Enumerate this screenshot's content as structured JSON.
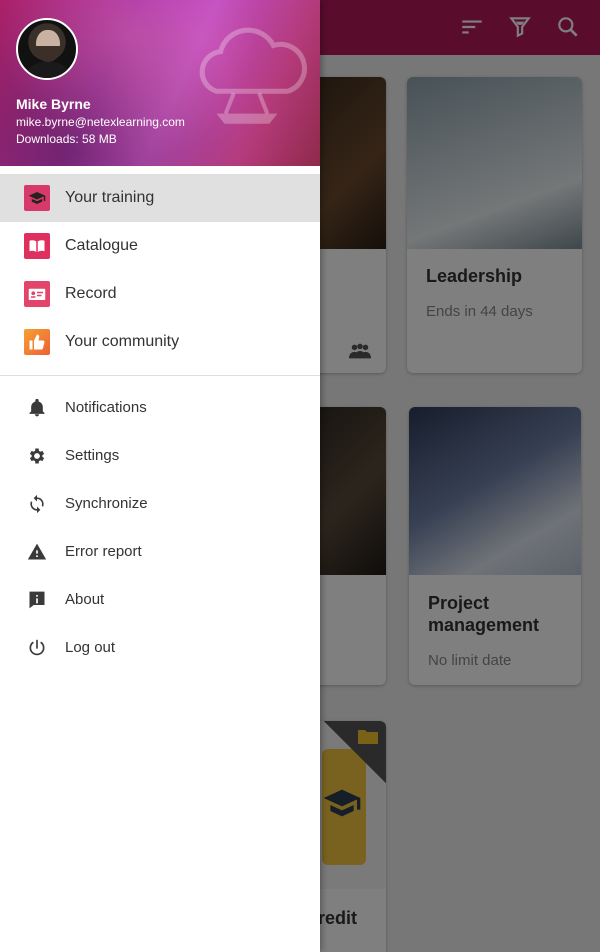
{
  "drawer": {
    "user": {
      "name": "Mike Byrne",
      "email": "mike.byrne@netexlearning.com",
      "downloads": "Downloads: 58 MB"
    },
    "main_items": [
      {
        "label": "Your training",
        "icon": "graduation-cap-icon",
        "selected": true
      },
      {
        "label": "Catalogue",
        "icon": "book-icon",
        "selected": false
      },
      {
        "label": "Record",
        "icon": "id-card-icon",
        "selected": false
      },
      {
        "label": "Your community",
        "icon": "thumbs-up-icon",
        "selected": false
      }
    ],
    "system_items": [
      {
        "label": "Notifications",
        "icon": "bell-icon"
      },
      {
        "label": "Settings",
        "icon": "gear-icon"
      },
      {
        "label": "Synchronize",
        "icon": "sync-icon"
      },
      {
        "label": "Error report",
        "icon": "warning-icon"
      },
      {
        "label": "About",
        "icon": "info-icon"
      },
      {
        "label": "Log out",
        "icon": "power-icon"
      }
    ]
  },
  "appbar": {
    "actions": [
      "sort-icon",
      "filter-icon",
      "search-icon"
    ]
  },
  "cards": [
    {
      "title": "",
      "subtitle": ""
    },
    {
      "title": "Leadership",
      "subtitle": "Ends in 44 days"
    },
    {
      "title": "",
      "subtitle": ""
    },
    {
      "title": "Project management",
      "subtitle": "No limit date"
    },
    {
      "title": "redit",
      "subtitle": ""
    }
  ],
  "colors": {
    "accent": "#b5195a",
    "selected_bg": "#e0e0e0"
  }
}
